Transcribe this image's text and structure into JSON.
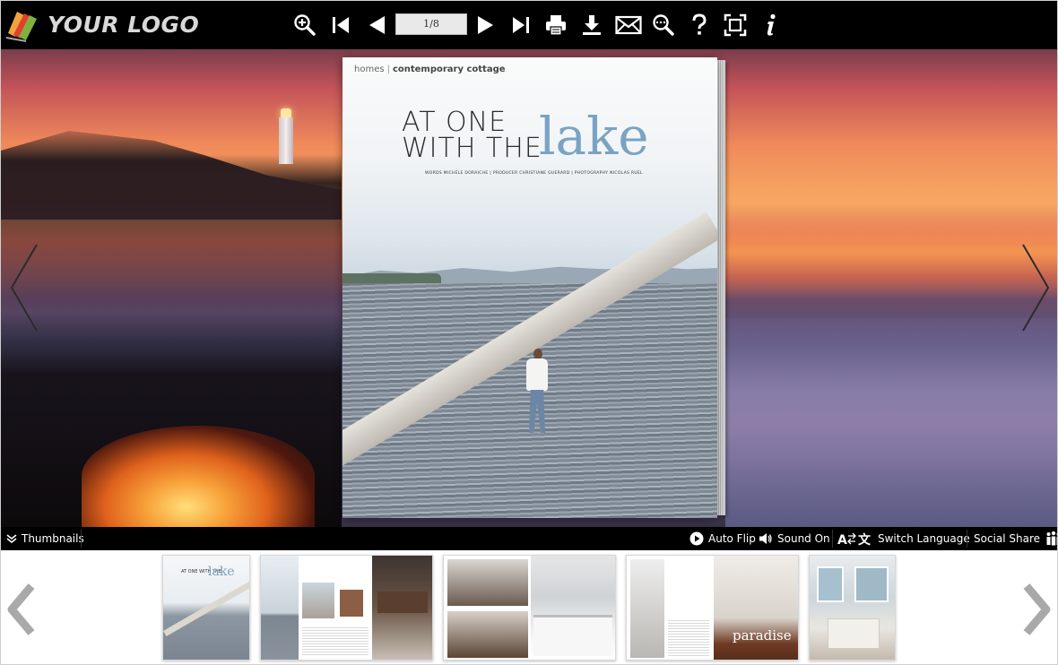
{
  "brand": {
    "logo_text": "YOUR LOGO"
  },
  "toolbar": {
    "page_indicator": "1/8",
    "buttons": [
      {
        "name": "zoom-in"
      },
      {
        "name": "first-page"
      },
      {
        "name": "previous-page"
      },
      {
        "name": "next-page"
      },
      {
        "name": "last-page"
      },
      {
        "name": "print"
      },
      {
        "name": "download"
      },
      {
        "name": "email"
      },
      {
        "name": "search"
      },
      {
        "name": "help"
      },
      {
        "name": "fullscreen"
      },
      {
        "name": "info"
      }
    ]
  },
  "page": {
    "section": "homes",
    "topic": "contemporary cottage",
    "headline_line1": "AT ONE",
    "headline_line2": "WITH THE",
    "headline_accent": "lake",
    "credits": "WORDS MICHELE DORAICHE  |  PRODUCER CHRISTIANE GUERARD  |  PHOTOGRAPHY NICOLAS RUEL"
  },
  "bottombar": {
    "thumbnails_label": "Thumbnails",
    "auto_flip_label": "Auto Flip",
    "sound_label": "Sound On",
    "language_label": "Switch Language",
    "share_label": "Social Share"
  },
  "thumbnails": {
    "t1_headline": "AT ONE WITH THE",
    "t1_accent": "lake",
    "t4_accent": "paradise"
  },
  "colors": {
    "toolbar_bg": "#000000",
    "accent_blue": "#7aa3c3",
    "bar_text": "#ffffff"
  }
}
